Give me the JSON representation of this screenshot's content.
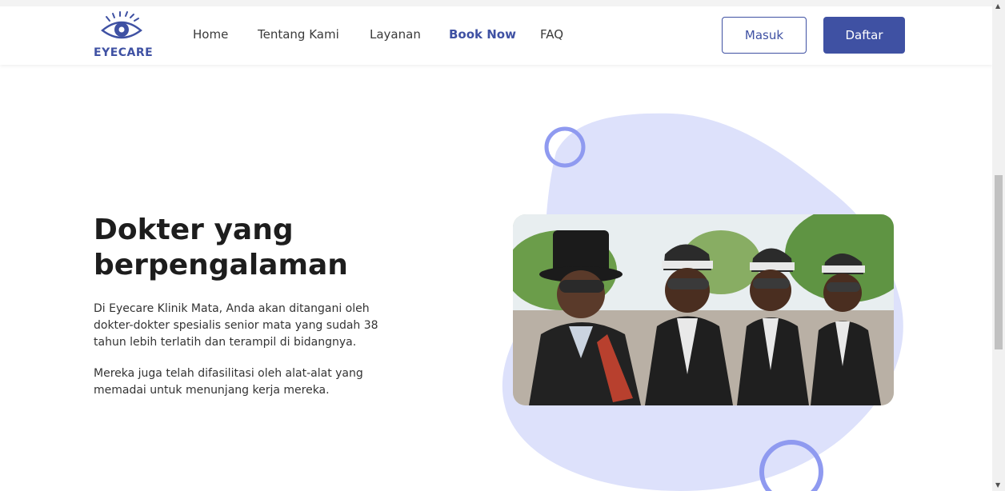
{
  "navbar": {
    "logo_text": "EYECARE",
    "links": [
      "Home",
      "Tentang Kami",
      "Layanan",
      "Book Now",
      "FAQ"
    ],
    "active_link": "Book Now",
    "login_label": "Masuk",
    "register_label": "Daftar"
  },
  "hero": {
    "heading": "Dokter yang berpengalaman",
    "paragraph1": "Di Eyecare Klinik Mata, Anda akan ditangani oleh dokter-dokter spesialis senior mata yang sudah 38 tahun lebih terlatih dan terampil di bidangnya.",
    "paragraph2": "Mereka juga telah difasilitasi oleh alat-alat yang memadai untuk menunjang kerja mereka."
  },
  "colors": {
    "brand": "#3f51a3",
    "blob": "#dde1fb",
    "ring": "#8f9af0"
  },
  "icons": [
    "eye-logo-icon",
    "scroll-up-icon",
    "scroll-down-icon"
  ]
}
